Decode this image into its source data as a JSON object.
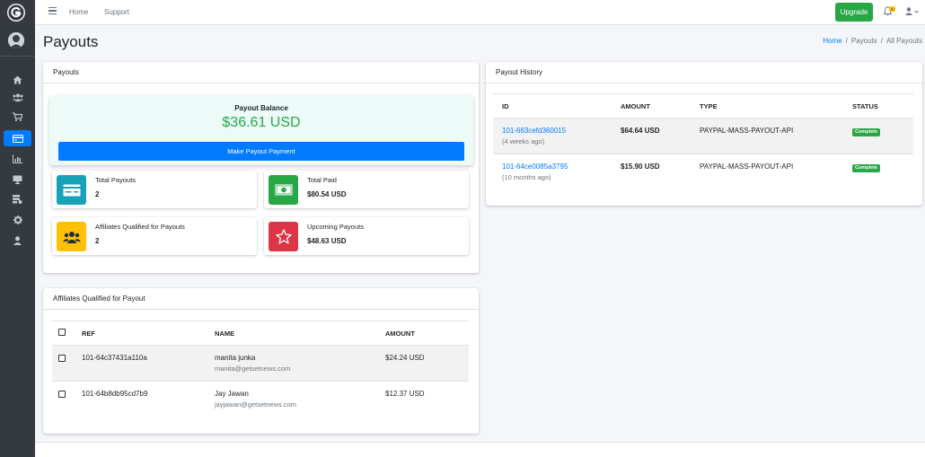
{
  "topbar": {
    "nav_links": [
      "Home",
      "Support"
    ],
    "upgrade_label": "Upgrade",
    "notification_count": "0"
  },
  "page": {
    "title": "Payouts",
    "breadcrumb": [
      "Home",
      "Payouts",
      "All Payouts"
    ]
  },
  "payouts_card": {
    "header": "Payouts",
    "balance_label": "Payout Balance",
    "balance_value": "$36.61 USD",
    "pay_button": "Make Payout Payment",
    "info_boxes": [
      {
        "label": "Total Payouts",
        "value": "2",
        "color": "#17a2b8",
        "icon": "money-check-icon"
      },
      {
        "label": "Total Paid",
        "value": "$80.54 USD",
        "color": "#28a745",
        "icon": "money-bill-icon"
      },
      {
        "label": "Affiliates Qualified for Payouts",
        "value": "2",
        "color": "#ffc107",
        "icon": "users-icon"
      },
      {
        "label": "Upcoming Payouts",
        "value": "$48.63 USD",
        "color": "#dc3545",
        "icon": "star-icon"
      }
    ]
  },
  "qualified_card": {
    "header": "Affiliates Qualified for Payout",
    "columns": [
      "REF",
      "NAME",
      "AMOUNT"
    ],
    "rows": [
      {
        "ref": "101-64c37431a110a",
        "name": "manita junka",
        "email": "manita@getsetnews.com",
        "amount": "$24.24 USD"
      },
      {
        "ref": "101-64b8db95cd7b9",
        "name": "Jay Jawan",
        "email": "jayjawan@getsetnews.com",
        "amount": "$12.37 USD"
      }
    ]
  },
  "history_card": {
    "header": "Payout History",
    "columns": [
      "ID",
      "AMOUNT",
      "TYPE",
      "STATUS"
    ],
    "rows": [
      {
        "id": "101-663cefd360015",
        "ago": "(4 weeks ago)",
        "amount": "$64.64 USD",
        "type": "PAYPAL-MASS-PAYOUT-API",
        "status": "Complete"
      },
      {
        "id": "101-64ce0085a3795",
        "ago": "(10 months ago)",
        "amount": "$15.90 USD",
        "type": "PAYPAL-MASS-PAYOUT-API",
        "status": "Complete"
      }
    ]
  },
  "sidebar": {
    "items": [
      "home-icon",
      "users-icon",
      "cart-icon",
      "credit-card-icon",
      "chart-icon",
      "desktop-icon",
      "tasks-icon",
      "cog-icon",
      "user-icon"
    ],
    "active_index": 3
  }
}
